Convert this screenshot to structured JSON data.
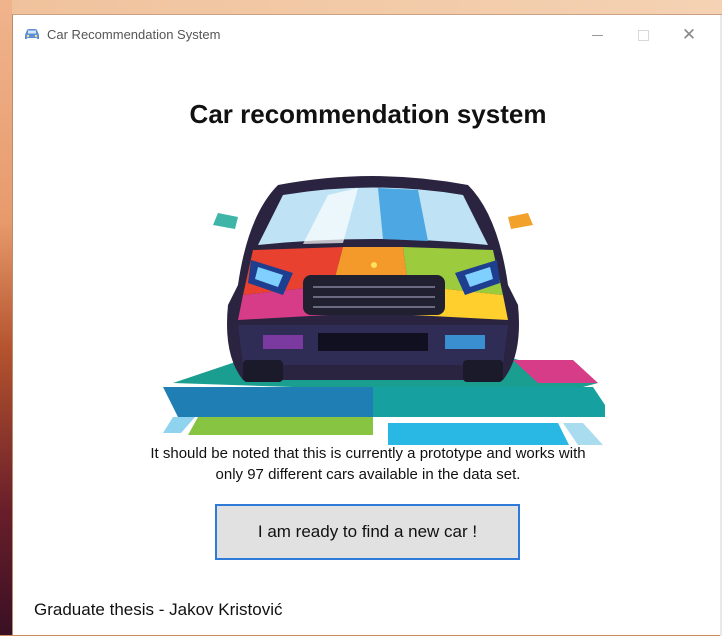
{
  "window": {
    "title": "Car Recommendation System",
    "controls": {
      "minimize": "—",
      "close": "✕"
    }
  },
  "main": {
    "heading": "Car recommendation system",
    "note_line1": "It should be noted that this is currently a prototype and works with",
    "note_line2": "only 97 different cars available in the data set.",
    "button_label": "I am ready to find a new car !"
  },
  "footer": {
    "credit": "Graduate thesis - Jakov Kristović"
  },
  "colors": {
    "button_border": "#2f7bd9",
    "button_bg": "#e1e1e1",
    "window_bg": "#ffffff"
  },
  "icons": {
    "app": "car-icon",
    "minimize": "minimize-icon",
    "maximize": "maximize-icon",
    "close": "close-icon"
  }
}
